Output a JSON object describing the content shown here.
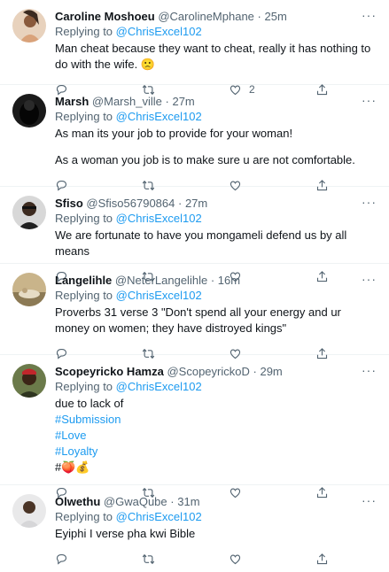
{
  "tweets": [
    {
      "name": "Caroline Moshoeu",
      "handle": "@CarolineMphane",
      "time": "25m",
      "replying_prefix": "Replying to",
      "replying_to": "@ChrisExcel102",
      "lines": [
        "Man cheat because they want to cheat, really it has nothing to do with the wife. 🙁"
      ],
      "like_count": "2"
    },
    {
      "name": "Marsh",
      "handle": "@Marsh_ville",
      "time": "27m",
      "replying_prefix": "Replying to",
      "replying_to": "@ChrisExcel102",
      "lines": [
        "As man its your job to provide for your woman!",
        "As a woman you job is to make sure u are not comfortable."
      ],
      "like_count": ""
    },
    {
      "name": "Sfiso",
      "handle": "@Sfiso56790864",
      "time": "27m",
      "replying_prefix": "Replying to",
      "replying_to": "@ChrisExcel102",
      "lines": [
        "We are fortunate to have you mongameli defend us by all means"
      ],
      "like_count": ""
    },
    {
      "name": "Langelihle",
      "handle": "@NeterLangelihle",
      "time": "16m",
      "replying_prefix": "Replying to",
      "replying_to": "@ChrisExcel102",
      "lines": [
        "Proverbs 31 verse 3 \"Don't spend all your energy and ur money on women; they have distroyed kings\""
      ],
      "like_count": ""
    },
    {
      "name": "Scopeyricko Hamza",
      "handle": "@ScopeyrickoD",
      "time": "29m",
      "replying_prefix": "Replying to",
      "replying_to": "@ChrisExcel102",
      "lines": [
        "due to lack of"
      ],
      "hashtags": [
        "#Submission",
        "#Love",
        "#Loyalty"
      ],
      "emoji_line": "#🍑💰",
      "like_count": ""
    },
    {
      "name": "Olwethu",
      "handle": "@GwaQube",
      "time": "31m",
      "replying_prefix": "Replying to",
      "replying_to": "@ChrisExcel102",
      "lines": [
        "Eyiphi I verse pha kwi Bible"
      ],
      "like_count": ""
    }
  ],
  "separator_dot": "·",
  "more_glyph": "···",
  "icons": {
    "reply": "reply-icon",
    "retweet": "retweet-icon",
    "like": "like-icon",
    "share": "share-icon"
  },
  "colors": {
    "link": "#1d9bf0",
    "muted": "#536471",
    "text": "#0f1419",
    "border": "#eff3f4"
  }
}
